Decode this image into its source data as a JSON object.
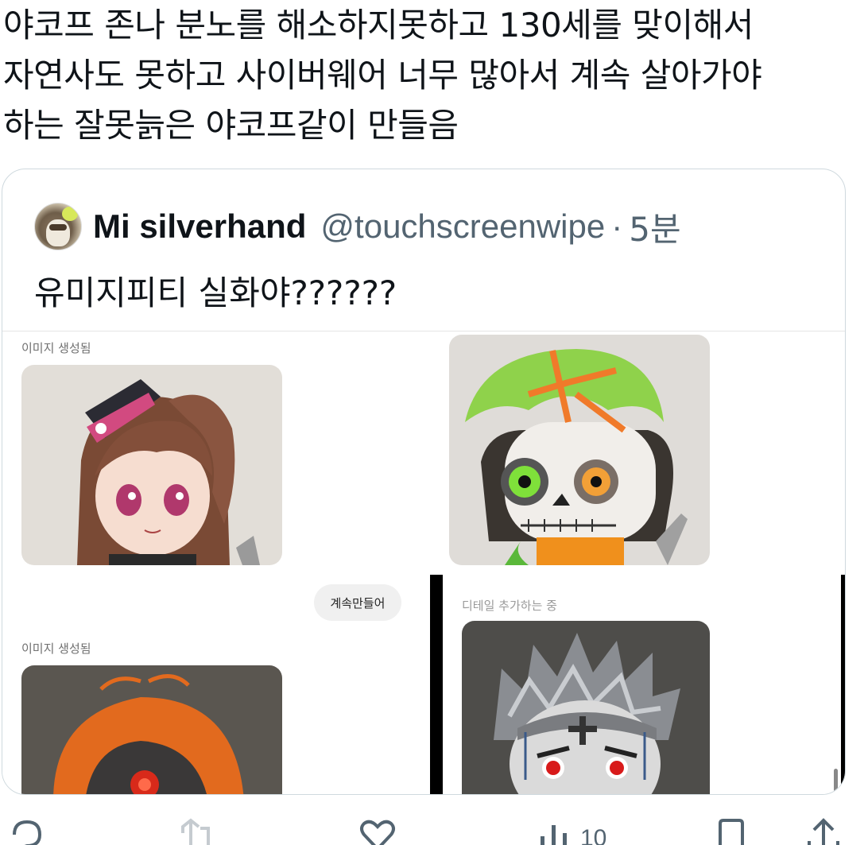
{
  "tweet": {
    "text": "야코프 존나 분노를 해소하지못하고 130세를 맞이해서\n자연사도 못하고 사이버웨어 너무 많아서 계속 살아가야\n하는 잘못늙은 야코프같이 만들음"
  },
  "quote": {
    "display_name": "Mi silverhand",
    "handle": "@touchscreenwipe",
    "separator": "·",
    "time": "5분",
    "text": "유미지피티 실화야??????",
    "media": {
      "label_generated_1": "이미지 생성됨",
      "label_generated_2": "이미지 생성됨",
      "label_detail": "디테일 추가하는 중",
      "continue_button": "계속만들어"
    }
  },
  "actions": {
    "reply_icon": "speech-bubble-icon",
    "retweet_icon": "retweet-icon",
    "like_icon": "heart-icon",
    "views_icon": "bar-chart-icon",
    "views_count": "10",
    "bookmark_icon": "bookmark-icon",
    "share_icon": "share-icon"
  },
  "colors": {
    "text": "#0f1419",
    "secondary": "#536471",
    "border": "#cfd9de"
  }
}
